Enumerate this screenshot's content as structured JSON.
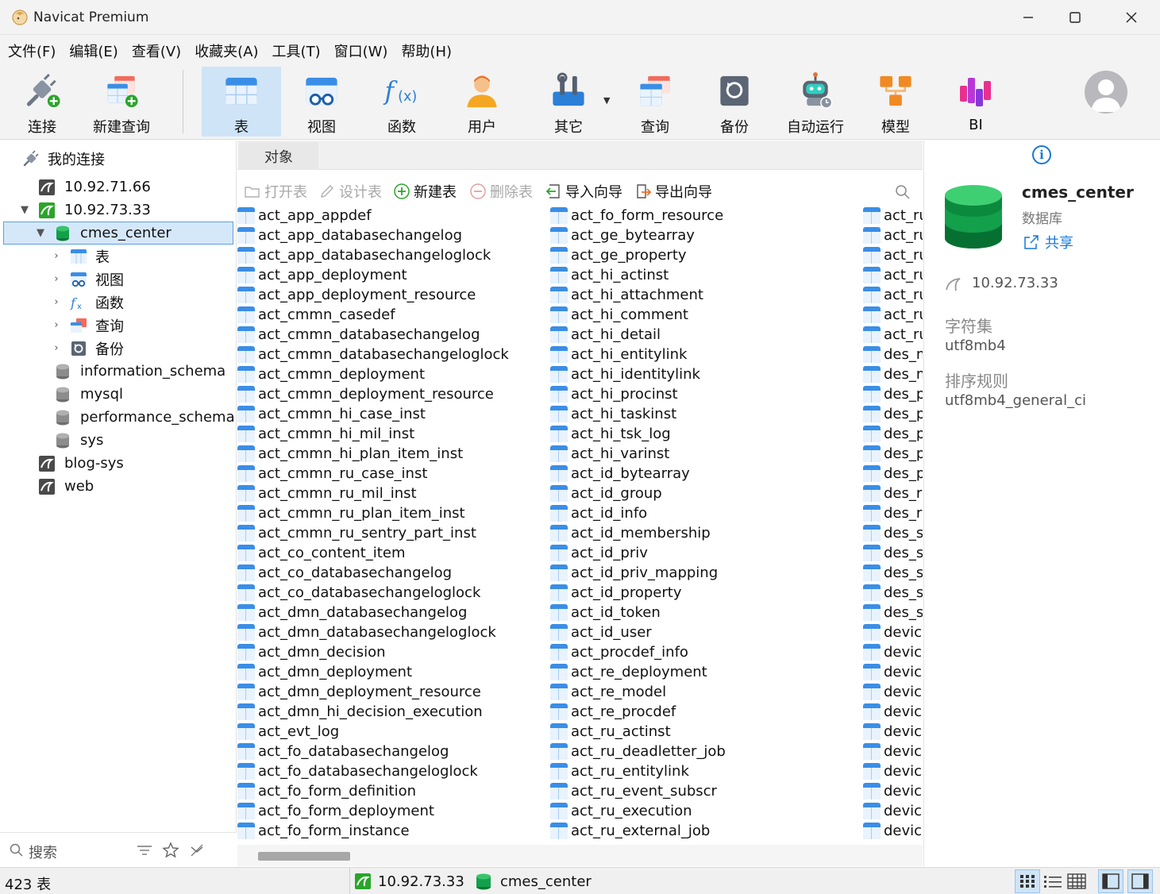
{
  "app": {
    "title": "Navicat Premium",
    "window_controls": [
      "minimize-icon",
      "maximize-icon",
      "close-icon"
    ]
  },
  "menu": [
    "文件(F)",
    "编辑(E)",
    "查看(V)",
    "收藏夹(A)",
    "工具(T)",
    "窗口(W)",
    "帮助(H)"
  ],
  "toolbar": {
    "connect": "连接",
    "new_query": "新建查询",
    "table": "表",
    "view": "视图",
    "function": "函数",
    "user": "用户",
    "other": "其它",
    "query": "查询",
    "backup": "备份",
    "automation": "自动运行",
    "model": "模型",
    "bi": "BI",
    "active": "表"
  },
  "tree": {
    "root": "我的连接",
    "items": [
      {
        "label": "10.92.71.66",
        "icon": "mysql-connection-icon",
        "expanded": false
      },
      {
        "label": "10.92.73.33",
        "icon": "mysql-connection-active-icon",
        "expanded": true
      },
      {
        "label": "cmes_center",
        "icon": "database-open-icon",
        "expanded": true,
        "selected": true
      },
      {
        "label": "表",
        "icon": "table-icon"
      },
      {
        "label": "视图",
        "icon": "view-icon"
      },
      {
        "label": "函数",
        "icon": "function-icon"
      },
      {
        "label": "查询",
        "icon": "query-icon"
      },
      {
        "label": "备份",
        "icon": "backup-icon"
      },
      {
        "label": "information_schema",
        "icon": "database-icon"
      },
      {
        "label": "mysql",
        "icon": "database-icon"
      },
      {
        "label": "performance_schema",
        "icon": "database-icon"
      },
      {
        "label": "sys",
        "icon": "database-icon"
      },
      {
        "label": "blog-sys",
        "icon": "mysql-connection-icon"
      },
      {
        "label": "web",
        "icon": "mysql-connection-icon"
      }
    ],
    "search_placeholder": "搜索"
  },
  "objects": {
    "tab": "对象",
    "toolbar": {
      "open": "打开表",
      "design": "设计表",
      "new": "新建表",
      "delete": "删除表",
      "import": "导入向导",
      "export": "导出向导"
    },
    "columns": [
      [
        "act_app_appdef",
        "act_app_databasechangelog",
        "act_app_databasechangeloglock",
        "act_app_deployment",
        "act_app_deployment_resource",
        "act_cmmn_casedef",
        "act_cmmn_databasechangelog",
        "act_cmmn_databasechangeloglock",
        "act_cmmn_deployment",
        "act_cmmn_deployment_resource",
        "act_cmmn_hi_case_inst",
        "act_cmmn_hi_mil_inst",
        "act_cmmn_hi_plan_item_inst",
        "act_cmmn_ru_case_inst",
        "act_cmmn_ru_mil_inst",
        "act_cmmn_ru_plan_item_inst",
        "act_cmmn_ru_sentry_part_inst",
        "act_co_content_item",
        "act_co_databasechangelog",
        "act_co_databasechangeloglock",
        "act_dmn_databasechangelog",
        "act_dmn_databasechangeloglock",
        "act_dmn_decision",
        "act_dmn_deployment",
        "act_dmn_deployment_resource",
        "act_dmn_hi_decision_execution",
        "act_evt_log",
        "act_fo_databasechangelog",
        "act_fo_databasechangeloglock",
        "act_fo_form_definition",
        "act_fo_form_deployment",
        "act_fo_form_instance"
      ],
      [
        "act_fo_form_resource",
        "act_ge_bytearray",
        "act_ge_property",
        "act_hi_actinst",
        "act_hi_attachment",
        "act_hi_comment",
        "act_hi_detail",
        "act_hi_entitylink",
        "act_hi_identitylink",
        "act_hi_procinst",
        "act_hi_taskinst",
        "act_hi_tsk_log",
        "act_hi_varinst",
        "act_id_bytearray",
        "act_id_group",
        "act_id_info",
        "act_id_membership",
        "act_id_priv",
        "act_id_priv_mapping",
        "act_id_property",
        "act_id_token",
        "act_id_user",
        "act_procdef_info",
        "act_re_deployment",
        "act_re_model",
        "act_re_procdef",
        "act_ru_actinst",
        "act_ru_deadletter_job",
        "act_ru_entitylink",
        "act_ru_event_subscr",
        "act_ru_execution",
        "act_ru_external_job"
      ],
      [
        "act_ru",
        "act_ru",
        "act_ru",
        "act_ru",
        "act_ru",
        "act_ru",
        "act_ru",
        "des_m",
        "des_m",
        "des_p",
        "des_p",
        "des_p",
        "des_p",
        "des_p",
        "des_re",
        "des_re",
        "des_sa",
        "des_sa",
        "des_sa",
        "des_sa",
        "des_sa",
        "device",
        "device",
        "device",
        "device",
        "device",
        "device",
        "device",
        "device",
        "device",
        "device",
        "device"
      ]
    ]
  },
  "info_panel": {
    "name": "cmes_center",
    "type": "数据库",
    "share": "共享",
    "host": "10.92.73.33",
    "charset_label": "字符集",
    "charset": "utf8mb4",
    "collation_label": "排序规则",
    "collation": "utf8mb4_general_ci"
  },
  "status": {
    "count": "423 表",
    "connection": "10.92.73.33",
    "database": "cmes_center"
  },
  "colors": {
    "accent": "#1677d9",
    "active_tab": "#cfe4f7",
    "selection": "#d5e8fa",
    "db_green": "#13a04a",
    "mysql_green": "#2aa52a"
  }
}
